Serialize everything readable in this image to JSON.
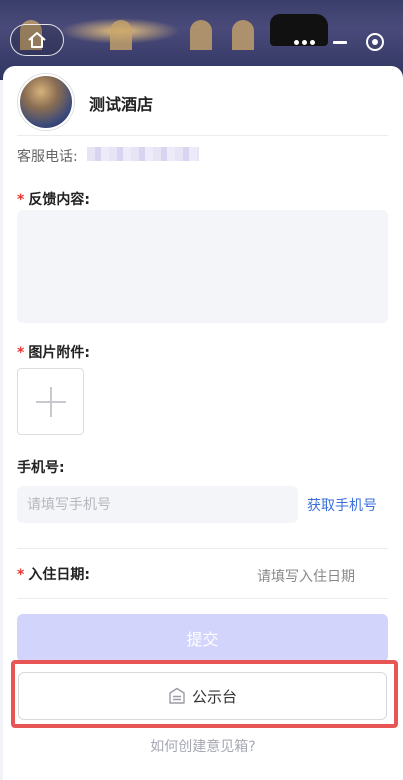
{
  "hotel": {
    "name": "测试酒店"
  },
  "contact": {
    "phone_label": "客服电话:"
  },
  "form": {
    "feedback_label": "反馈内容:",
    "required_mark": "*",
    "attachment_label": "图片附件:",
    "phone_label": "手机号:",
    "phone_placeholder": "请填写手机号",
    "get_phone_label": "获取手机号",
    "checkin_label": "入住日期:",
    "checkin_placeholder": "请填写入住日期",
    "submit_label": "提交"
  },
  "notice_board": {
    "label": "公示台"
  },
  "help": {
    "link_text": "如何创建意见箱?"
  },
  "colors": {
    "required": "#e33333",
    "link": "#3a6fdb",
    "submit_bg": "#d2d4fb",
    "highlight": "#e85555"
  },
  "icons": [
    "home-icon",
    "more-dots-icon",
    "minimize-icon",
    "close-target-icon",
    "plus-icon",
    "notice-board-icon"
  ]
}
